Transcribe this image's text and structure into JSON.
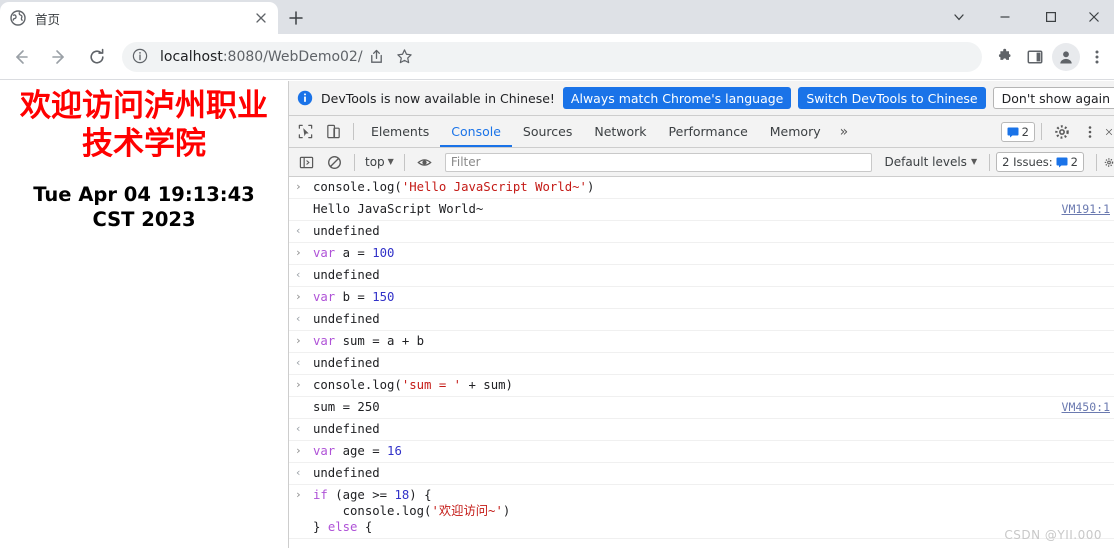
{
  "browser": {
    "tab": {
      "title": "首页",
      "favicon": "globe-icon",
      "close_label": "×"
    },
    "new_tab_label": "+",
    "window_controls": {
      "tab_search": "tab-search-chevron",
      "minimize": "−",
      "maximize": "□",
      "close": "✕"
    },
    "nav": {
      "back": "←",
      "forward": "→",
      "reload": "⟳"
    },
    "omnibox": {
      "site_info_icon": "info-circle-icon",
      "url_host": "localhost",
      "url_rest": ":8080/WebDemo02/",
      "url_full": "localhost:8080/WebDemo02/",
      "share_icon": "share-icon",
      "bookmark_icon": "star-icon"
    },
    "toolbar_icons": {
      "extensions": "puzzle-icon",
      "side_panel": "side-panel-icon",
      "profile": "avatar-icon",
      "menu": "three-dot-menu-icon"
    }
  },
  "page": {
    "heading": "欢迎访问泸州职业技术学院",
    "heading_color": "#ff0000",
    "date_text": "Tue Apr 04 19:13:43 CST 2023"
  },
  "devtools": {
    "banner": {
      "icon": "info-icon",
      "message": "DevTools is now available in Chinese!",
      "btn_always_match": "Always match Chrome's language",
      "btn_switch": "Switch DevTools to Chinese",
      "btn_dont_show": "Don't show again"
    },
    "tabs": {
      "inspect_icon": "inspect-cursor-icon",
      "device_icon": "device-toolbar-icon",
      "items": [
        {
          "label": "Elements",
          "selected": false
        },
        {
          "label": "Console",
          "selected": true
        },
        {
          "label": "Sources",
          "selected": false
        },
        {
          "label": "Network",
          "selected": false
        },
        {
          "label": "Performance",
          "selected": false
        },
        {
          "label": "Memory",
          "selected": false
        }
      ],
      "overflow": "»",
      "issues_count": "2",
      "settings_icon": "gear-icon",
      "more_icon": "three-dot-menu-icon"
    },
    "filterbar": {
      "sidebar_icon": "console-sidebar-icon",
      "clear_icon": "clear-console-icon",
      "context": "top",
      "eye_icon": "live-expression-eye-icon",
      "filter_placeholder": "Filter",
      "filter_value": "",
      "levels": "Default levels",
      "issues_label": "2 Issues:",
      "issues_count": "2",
      "settings_icon": "settings-icon"
    },
    "console_rows": [
      {
        "kind": "input",
        "glyph": "›",
        "tokens": [
          {
            "t": "console.log(",
            "c": "plain"
          },
          {
            "t": "'Hello JavaScript World~'",
            "c": "str"
          },
          {
            "t": ")",
            "c": "plain"
          }
        ],
        "src": ""
      },
      {
        "kind": "output",
        "glyph": "",
        "tokens": [
          {
            "t": "Hello JavaScript World~",
            "c": "plain"
          }
        ],
        "src": "VM191:1"
      },
      {
        "kind": "result",
        "glyph": "‹",
        "tokens": [
          {
            "t": "undefined",
            "c": "plain"
          }
        ],
        "src": ""
      },
      {
        "kind": "input",
        "glyph": "›",
        "tokens": [
          {
            "t": "var",
            "c": "kw"
          },
          {
            "t": " a = ",
            "c": "plain"
          },
          {
            "t": "100",
            "c": "num"
          }
        ],
        "src": ""
      },
      {
        "kind": "result",
        "glyph": "‹",
        "tokens": [
          {
            "t": "undefined",
            "c": "plain"
          }
        ],
        "src": ""
      },
      {
        "kind": "input",
        "glyph": "›",
        "tokens": [
          {
            "t": "var",
            "c": "kw"
          },
          {
            "t": " b = ",
            "c": "plain"
          },
          {
            "t": "150",
            "c": "num"
          }
        ],
        "src": ""
      },
      {
        "kind": "result",
        "glyph": "‹",
        "tokens": [
          {
            "t": "undefined",
            "c": "plain"
          }
        ],
        "src": ""
      },
      {
        "kind": "input",
        "glyph": "›",
        "tokens": [
          {
            "t": "var",
            "c": "kw"
          },
          {
            "t": " sum = a + b",
            "c": "plain"
          }
        ],
        "src": ""
      },
      {
        "kind": "result",
        "glyph": "‹",
        "tokens": [
          {
            "t": "undefined",
            "c": "plain"
          }
        ],
        "src": ""
      },
      {
        "kind": "input",
        "glyph": "›",
        "tokens": [
          {
            "t": "console.log(",
            "c": "plain"
          },
          {
            "t": "'sum = '",
            "c": "str"
          },
          {
            "t": " + sum)",
            "c": "plain"
          }
        ],
        "src": ""
      },
      {
        "kind": "output",
        "glyph": "",
        "tokens": [
          {
            "t": "sum = 250",
            "c": "plain"
          }
        ],
        "src": "VM450:1"
      },
      {
        "kind": "result",
        "glyph": "‹",
        "tokens": [
          {
            "t": "undefined",
            "c": "plain"
          }
        ],
        "src": ""
      },
      {
        "kind": "input",
        "glyph": "›",
        "tokens": [
          {
            "t": "var",
            "c": "kw"
          },
          {
            "t": " age = ",
            "c": "plain"
          },
          {
            "t": "16",
            "c": "num"
          }
        ],
        "src": ""
      },
      {
        "kind": "result",
        "glyph": "‹",
        "tokens": [
          {
            "t": "undefined",
            "c": "plain"
          }
        ],
        "src": ""
      },
      {
        "kind": "input",
        "glyph": "›",
        "tokens": [
          {
            "t": "if",
            "c": "kw"
          },
          {
            "t": " (age >= ",
            "c": "plain"
          },
          {
            "t": "18",
            "c": "num"
          },
          {
            "t": ") {\n    console.log(",
            "c": "plain"
          },
          {
            "t": "'欢迎访问~'",
            "c": "str"
          },
          {
            "t": ")\n} ",
            "c": "plain"
          },
          {
            "t": "else",
            "c": "kw"
          },
          {
            "t": " {",
            "c": "plain"
          }
        ],
        "src": ""
      }
    ]
  },
  "watermark": "CSDN @YII.000"
}
